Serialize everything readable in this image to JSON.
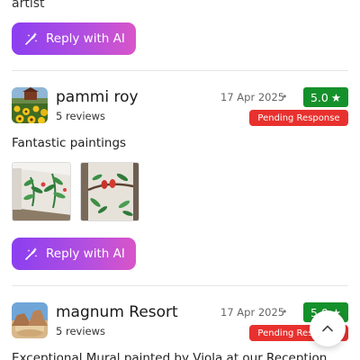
{
  "top_text": "artist",
  "reply_button_label": "Reply with AI",
  "reviews": [
    {
      "name": "pammi roy",
      "reviews_count": "5 reviews",
      "date": "17 Apr 2025",
      "separator": "•",
      "rating": "5.0",
      "rating_star": "★",
      "status": "Pending Response",
      "text": "Fantastic paintings",
      "avatar_icon": "sunflower-field-photo",
      "photos": [
        "mural-corridor-photo",
        "mural-birds-photo"
      ]
    },
    {
      "name": "magnum Resort",
      "reviews_count": "5 reviews",
      "date": "17 Apr 2025",
      "separator": "•",
      "rating": "5.0",
      "rating_star": "★",
      "status": "Pending Response",
      "text": "Exceptional Mural painted by Viola at our Reception",
      "avatar_icon": "desert-rocks-photo"
    }
  ],
  "colors": {
    "rating_green": "#15912b",
    "pending_red": "#e8312e",
    "ai_gradient_start": "#8b3ff0",
    "ai_gradient_end": "#d955c8"
  },
  "scroll_icon": "chevron-up-icon"
}
